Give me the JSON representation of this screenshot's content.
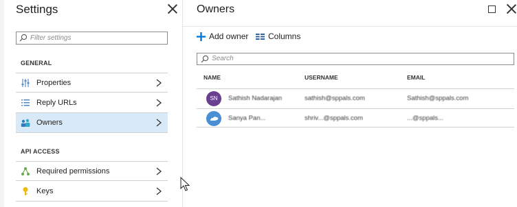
{
  "settings": {
    "title": "Settings",
    "filter_placeholder": "Filter settings",
    "sections": [
      {
        "label": "GENERAL",
        "items": [
          {
            "label": "Properties",
            "icon": "properties-sliders-icon"
          },
          {
            "label": "Reply URLs",
            "icon": "list-icon"
          },
          {
            "label": "Owners",
            "icon": "users-icon",
            "selected": true
          }
        ]
      },
      {
        "label": "API ACCESS",
        "items": [
          {
            "label": "Required permissions",
            "icon": "permissions-tree-icon"
          },
          {
            "label": "Keys",
            "icon": "key-icon"
          }
        ]
      }
    ]
  },
  "owners": {
    "title": "Owners",
    "toolbar": {
      "add_owner_label": "Add owner",
      "columns_label": "Columns"
    },
    "search_placeholder": "Search",
    "columns": [
      "NAME",
      "USERNAME",
      "EMAIL"
    ],
    "rows": [
      {
        "avatar_text": "SN",
        "avatar_color": "#6b3f8f",
        "name": "Sathish Nadarajan",
        "username": "sathish@sppals.com",
        "email": "Sathish@sppals.com"
      },
      {
        "avatar_text": "",
        "avatar_color": "#4a8fd4",
        "name": "Sanya Pan...",
        "username": "shriv...@sppals.com",
        "email": "...@sppals..."
      }
    ]
  },
  "colors": {
    "accent": "#0078d4",
    "selected_bg": "#d8eaf8"
  }
}
